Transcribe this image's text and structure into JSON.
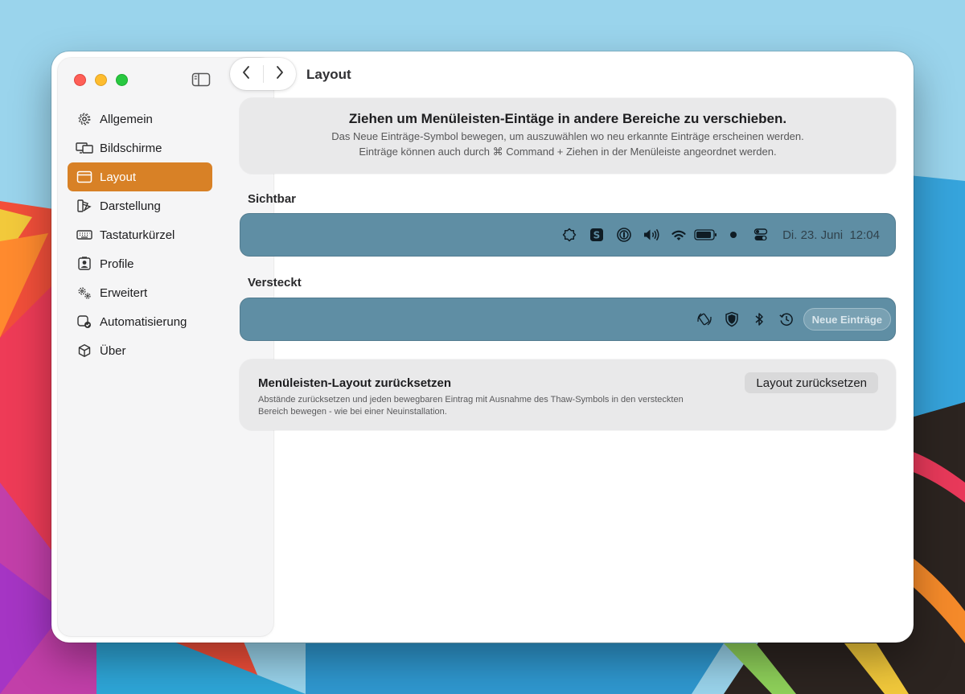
{
  "window": {
    "title": "Layout"
  },
  "sidebar": {
    "items": [
      {
        "label": "Allgemein",
        "icon": "gear-icon"
      },
      {
        "label": "Bildschirme",
        "icon": "displays-icon"
      },
      {
        "label": "Layout",
        "icon": "window-layout-icon",
        "selected": true
      },
      {
        "label": "Darstellung",
        "icon": "appearance-icon"
      },
      {
        "label": "Tastaturkürzel",
        "icon": "keyboard-icon"
      },
      {
        "label": "Profile",
        "icon": "profile-icon"
      },
      {
        "label": "Erweitert",
        "icon": "gears-icon"
      },
      {
        "label": "Automatisierung",
        "icon": "automation-icon"
      },
      {
        "label": "Über",
        "icon": "cube-icon"
      }
    ]
  },
  "info": {
    "title": "Ziehen um Menüleisten-Eintäge in andere Bereiche zu verschieben.",
    "line1": "Das Neue Einträge-Symbol bewegen, um auszuwählen wo neu erkannte Einträge erscheinen werden.",
    "line2": "Einträge können auch durch ⌘ Command + Ziehen in der Menüleiste angeordnet werden."
  },
  "visible_section": {
    "label": "Sichtbar",
    "icons": [
      "sun-icon",
      "skype-icon",
      "onepassword-icon",
      "volume-icon",
      "wifi-icon",
      "battery-icon",
      "dot-icon",
      "control-center-icon"
    ],
    "clock": "Di. 23. Juni  12:04"
  },
  "hidden_section": {
    "label": "Versteckt",
    "icons": [
      "rotation-icon",
      "shield-icon",
      "bluetooth-icon",
      "time-machine-icon"
    ],
    "new_items_label": "Neue Einträge"
  },
  "reset": {
    "title": "Menüleisten-Layout zurücksetzen",
    "description": "Abstände zurücksetzen und jeden bewegbaren Eintrag mit Ausnahme des Thaw-Symbols in den versteckten Bereich bewegen - wie bei einer Neuinstallation.",
    "button_label": "Layout zurücksetzen"
  },
  "colors": {
    "accent": "#d88126",
    "menu_bar": "#5f8ea4",
    "panel": "#e9e9ea"
  }
}
